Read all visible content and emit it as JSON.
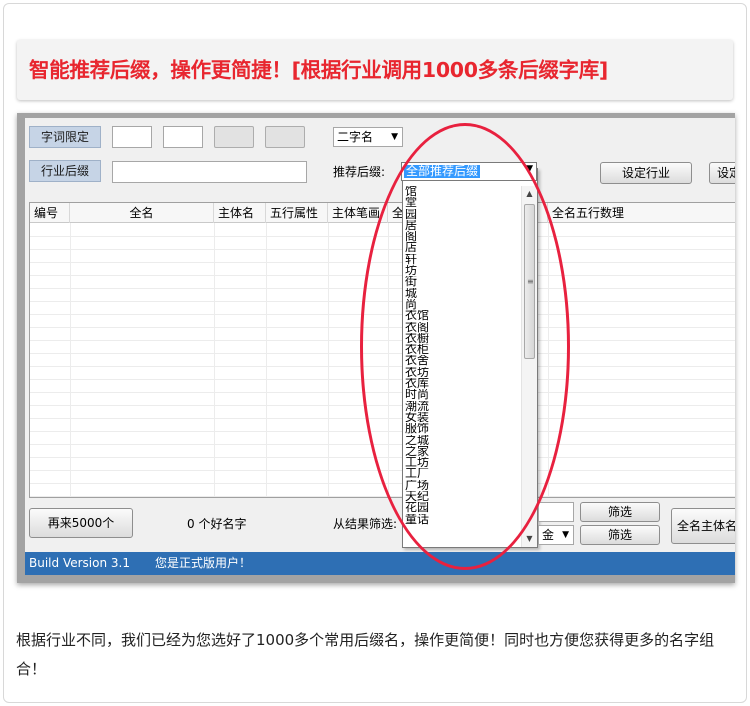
{
  "banner": {
    "text": "智能推荐后缀，操作更简捷！[根据行业调用1000多条后缀字库]"
  },
  "form": {
    "word_limit_label": "字词限定",
    "industry_suffix_label": "行业后缀",
    "name_type_value": "二字名",
    "recommend_label": "推荐后缀:",
    "set_industry_button": "设定行业",
    "set_button_partial": "设定"
  },
  "table": {
    "columns": [
      "编号",
      "全名",
      "主体名",
      "五行属性",
      "主体笔画",
      "全",
      "全名五行数理"
    ]
  },
  "dropdown": {
    "selected": "全部推荐后缀",
    "items": [
      "馆",
      "堂",
      "园",
      "居",
      "阁",
      "店",
      "轩",
      "坊",
      "街",
      "城",
      "尚",
      "衣馆",
      "衣阁",
      "衣橱",
      "衣柜",
      "衣舍",
      "衣坊",
      "衣库",
      "时尚",
      "潮流",
      "女装",
      "服饰",
      "之城",
      "之家",
      "工坊",
      "工厂",
      "广场",
      "天纪",
      "花园",
      "童话"
    ]
  },
  "bottom": {
    "more_button": "再来5000个",
    "good_count": "0 个好名字",
    "filter_label": "从结果筛选:",
    "filter_button_1": "筛选",
    "filter_button_2": "筛选",
    "element_value": "金",
    "fullname_button": "全名主体名"
  },
  "status": {
    "version": "Build Version 3.1",
    "user": "您是正式版用户！"
  },
  "description": "根据行业不同，我们已经为您选好了1000多个常用后缀名，操作更简便！同时也方便您获得更多的名字组合！"
}
